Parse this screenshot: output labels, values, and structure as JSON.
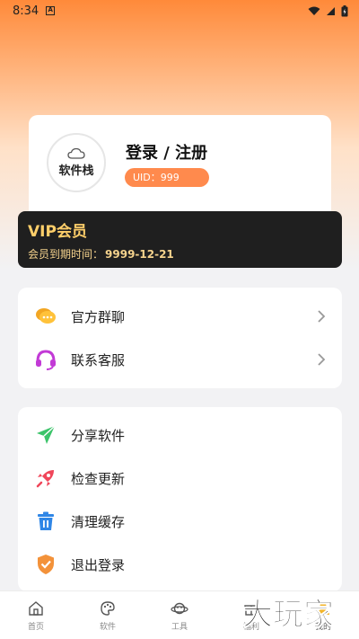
{
  "status": {
    "time": "8:34"
  },
  "profile": {
    "avatar_text": "软件栈",
    "login_label": "登录 / 注册",
    "uid_label": "UID：999"
  },
  "vip": {
    "title": "VIP会员",
    "expire_label": "会员到期时间：",
    "expire_value": "9999-12-21"
  },
  "menu_group_1": [
    {
      "label": "官方群聊",
      "icon": "chat-bubble-icon"
    },
    {
      "label": "联系客服",
      "icon": "headset-icon"
    }
  ],
  "menu_group_2": [
    {
      "label": "分享软件",
      "icon": "paper-plane-icon"
    },
    {
      "label": "检查更新",
      "icon": "rocket-icon"
    },
    {
      "label": "清理缓存",
      "icon": "trash-icon"
    },
    {
      "label": "退出登录",
      "icon": "shield-check-icon"
    }
  ],
  "tabbar": {
    "tabs": [
      {
        "label": "首页",
        "icon": "home-icon"
      },
      {
        "label": "软件",
        "icon": "palette-icon"
      },
      {
        "label": "工具",
        "icon": "planet-icon"
      },
      {
        "label": "福利",
        "icon": "gift-icon"
      },
      {
        "label": "我的",
        "icon": "user-icon"
      }
    ]
  },
  "watermark_text": "大玩家",
  "colors": {
    "accent_orange": "#ff8a4d",
    "vip_bg": "#1f1f1f",
    "vip_gold": "#ffcf6a"
  }
}
